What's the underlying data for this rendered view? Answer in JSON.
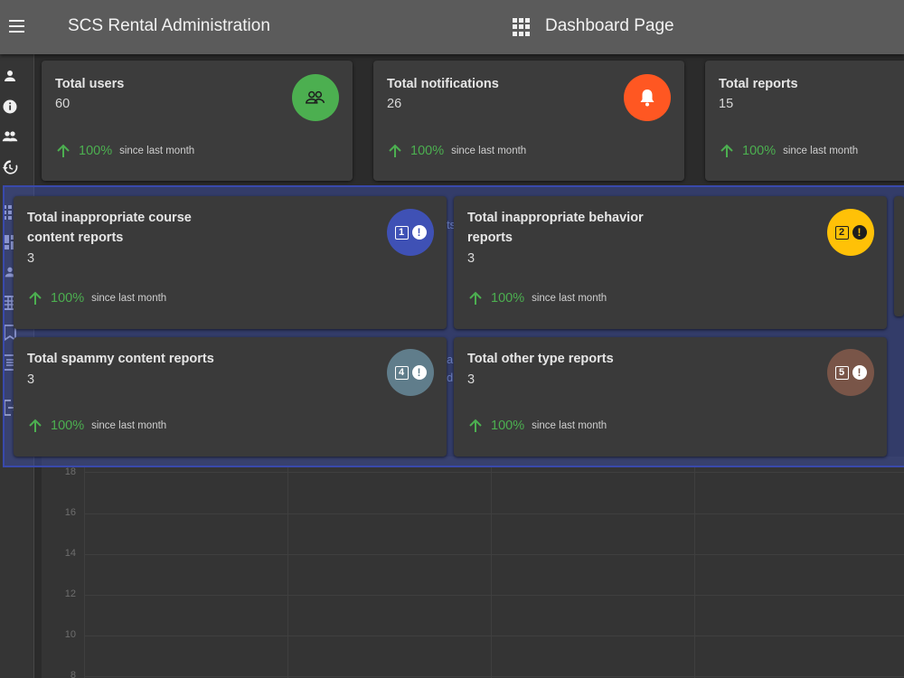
{
  "appbar": {
    "title": "SCS Rental Administration",
    "page_title": "Dashboard Page"
  },
  "sidebar": {
    "icons": [
      "person-icon",
      "info-icon",
      "people-icon",
      "history-icon",
      "apps-icon",
      "dashboard-icon",
      "person-icon",
      "grid-icon",
      "bookmark-icon",
      "list-icon",
      "logout-icon"
    ]
  },
  "top_cards": [
    {
      "title": "Total users",
      "value": "60",
      "trend_pct": "100%",
      "trend_text": "since last month",
      "icon": "users-icon",
      "color": "#4caf50"
    },
    {
      "title": "Total notifications",
      "value": "26",
      "trend_pct": "100%",
      "trend_text": "since last month",
      "icon": "bell-icon",
      "color": "#ff5722"
    },
    {
      "title": "Total reports",
      "value": "15",
      "trend_pct": "100%",
      "trend_text": "since last month",
      "icon": "reports-icon",
      "color": "#607d8b"
    }
  ],
  "report_cards": [
    {
      "title_line1": "Total inappropriate course",
      "title_line2": "content reports",
      "value": "3",
      "trend_pct": "100%",
      "trend_text": "since last month",
      "badge": "1",
      "color": "#3f51b5"
    },
    {
      "title_line1": "Total inappropriate behavior",
      "title_line2": "reports",
      "value": "3",
      "trend_pct": "100%",
      "trend_text": "since last month",
      "badge": "2",
      "color": "#ffc107"
    },
    {
      "title_line1": "Total spammy content reports",
      "title_line2": "",
      "value": "3",
      "trend_pct": "100%",
      "trend_text": "since last month",
      "badge": "4",
      "color": "#607d8b"
    },
    {
      "title_line1": "Total other type reports",
      "title_line2": "",
      "value": "3",
      "trend_pct": "100%",
      "trend_text": "since last month",
      "badge": "5",
      "color": "#795548"
    }
  ],
  "chart": {
    "y_ticks": [
      "18",
      "16",
      "14",
      "12",
      "10",
      "8"
    ]
  },
  "colors": {
    "positive": "#4caf50",
    "overlay": "#3f51b5"
  }
}
